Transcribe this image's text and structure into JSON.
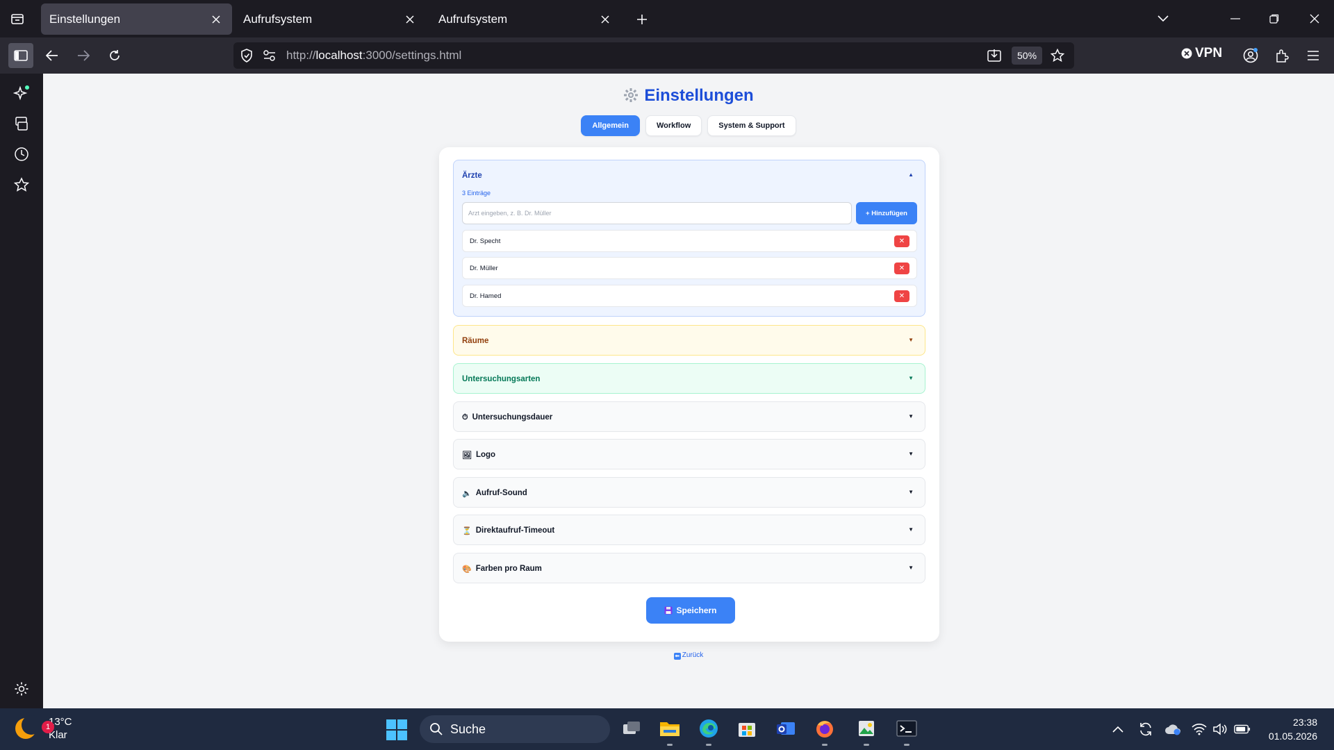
{
  "browser": {
    "tabs": [
      {
        "title": "Einstellungen",
        "active": true
      },
      {
        "title": "Aufrufsystem",
        "active": false
      },
      {
        "title": "Aufrufsystem",
        "active": false
      }
    ],
    "url_prefix": "http://",
    "url_host": "localhost",
    "url_rest": ":3000/settings.html",
    "zoom": "50%",
    "vpn_label": "VPN"
  },
  "page": {
    "title": "Einstellungen",
    "tabs": [
      "Allgemein",
      "Workflow",
      "System & Support"
    ],
    "active_tab": "Allgemein",
    "sections": {
      "aerzte": {
        "title": "Ärzte",
        "count": "3 Einträge",
        "input_placeholder": "Arzt eingeben, z. B. Dr. Müller",
        "add_label": "+ Hinzufügen",
        "doctors": [
          "Dr. Specht",
          "Dr. Müller",
          "Dr. Hamed"
        ],
        "delete_label": "✕",
        "expanded": true
      },
      "raeume": {
        "title": "Räume"
      },
      "untersuchungsarten": {
        "title": "Untersuchungsarten"
      },
      "untersuchungsdauer": {
        "title": "Untersuchungsdauer",
        "icon": "⏱"
      },
      "logo": {
        "title": "Logo",
        "icon": "🖼"
      },
      "aufruf_sound": {
        "title": "Aufruf-Sound",
        "icon": "🔈"
      },
      "direktaufruf_timeout": {
        "title": "Direktaufruf-Timeout",
        "icon": "⏳"
      },
      "farben": {
        "title": "Farben pro Raum",
        "icon": "🎨"
      }
    },
    "save_label": "Speichern",
    "back_label": "Zurück"
  },
  "taskbar": {
    "weather_temp": "13°C",
    "weather_desc": "Klar",
    "weather_badge": "1",
    "search_label": "Suche",
    "time": "23:38",
    "date": "01.05.2026"
  },
  "colors": {
    "accent": "#3b82f6",
    "danger": "#ef4444",
    "title": "#1d4ed8"
  }
}
